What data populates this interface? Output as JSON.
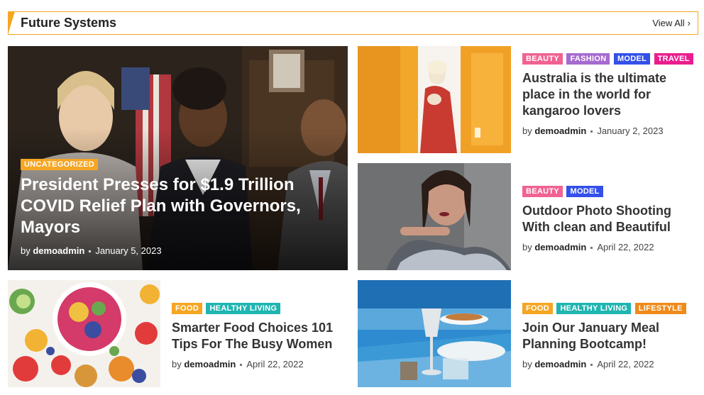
{
  "section": {
    "title": "Future Systems",
    "view_all": "View All",
    "accent_color": "#f5a623"
  },
  "hero": {
    "category": "UNCATEGORIZED",
    "title": "President Presses for $1.9 Trillion COVID Relief Plan with Governors, Mayors",
    "by": "by",
    "author": "demoadmin",
    "date": "January 5, 2023"
  },
  "posts": [
    {
      "categories": [
        "BEAUTY",
        "FASHION",
        "MODEL",
        "TRAVEL"
      ],
      "title": "Australia is the ultimate place in the world for kangaroo lovers",
      "by": "by",
      "author": "demoadmin",
      "date": "January 2, 2023"
    },
    {
      "categories": [
        "BEAUTY",
        "MODEL"
      ],
      "title": "Outdoor Photo Shooting With clean and Beautiful",
      "by": "by",
      "author": "demoadmin",
      "date": "April 22, 2022"
    },
    {
      "categories": [
        "FOOD",
        "HEALTHY LIVING"
      ],
      "title": "Smarter Food Choices 101 Tips For The Busy Women",
      "by": "by",
      "author": "demoadmin",
      "date": "April 22, 2022"
    },
    {
      "categories": [
        "FOOD",
        "HEALTHY LIVING",
        "LIFESTYLE"
      ],
      "title": "Join Our January Meal Planning Bootcamp!",
      "by": "by",
      "author": "demoadmin",
      "date": "April 22, 2022"
    }
  ]
}
